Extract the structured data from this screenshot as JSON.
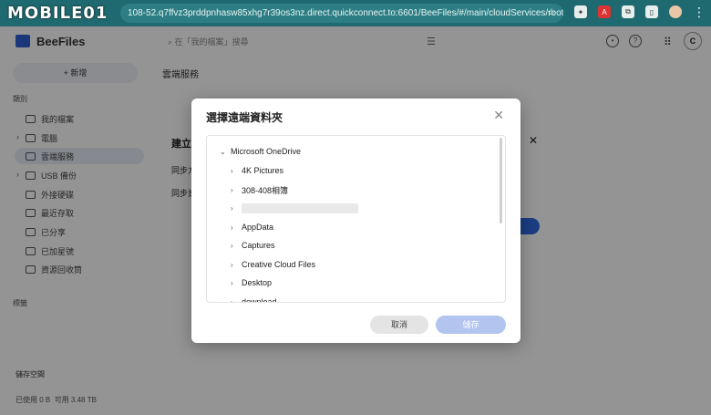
{
  "browser": {
    "watermark": "MOBILE01",
    "url": "108-52.q7ffvz3prddpnhasw85xhg7r39os3nz.direct.quickconnect.to:6601/BeeFiles/#/main/cloudServices/root"
  },
  "app": {
    "title": "BeeFiles",
    "search_placeholder": "在「我的檔案」搜尋",
    "user_initial": "C",
    "new_button": "新增",
    "breadcrumb": "雲端服務",
    "sidebar": {
      "category_header": "類別",
      "items": [
        {
          "label": "我的檔案"
        },
        {
          "label": "電腦"
        },
        {
          "label": "雲端服務"
        },
        {
          "label": "USB 備份"
        },
        {
          "label": "外接硬碟"
        },
        {
          "label": "最近存取"
        },
        {
          "label": "已分享"
        },
        {
          "label": "已加星號"
        },
        {
          "label": "資源回收筒"
        }
      ],
      "tags_header": "標籤",
      "storage_header": "儲存空間",
      "storage_used": "已使用 0 B",
      "storage_total": "可用 3.48 TB"
    }
  },
  "behind_dialog": {
    "title": "建立",
    "label1": "同步方",
    "label2": "同步資"
  },
  "modal": {
    "title": "選擇遠端資料夾",
    "tree_root": "Microsoft OneDrive",
    "folders": [
      "4K Pictures",
      "308-408相簿",
      "",
      "AppData",
      "Captures",
      "Creative Cloud Files",
      "Desktop",
      "download"
    ],
    "cancel_label": "取消",
    "save_label": "儲存"
  }
}
